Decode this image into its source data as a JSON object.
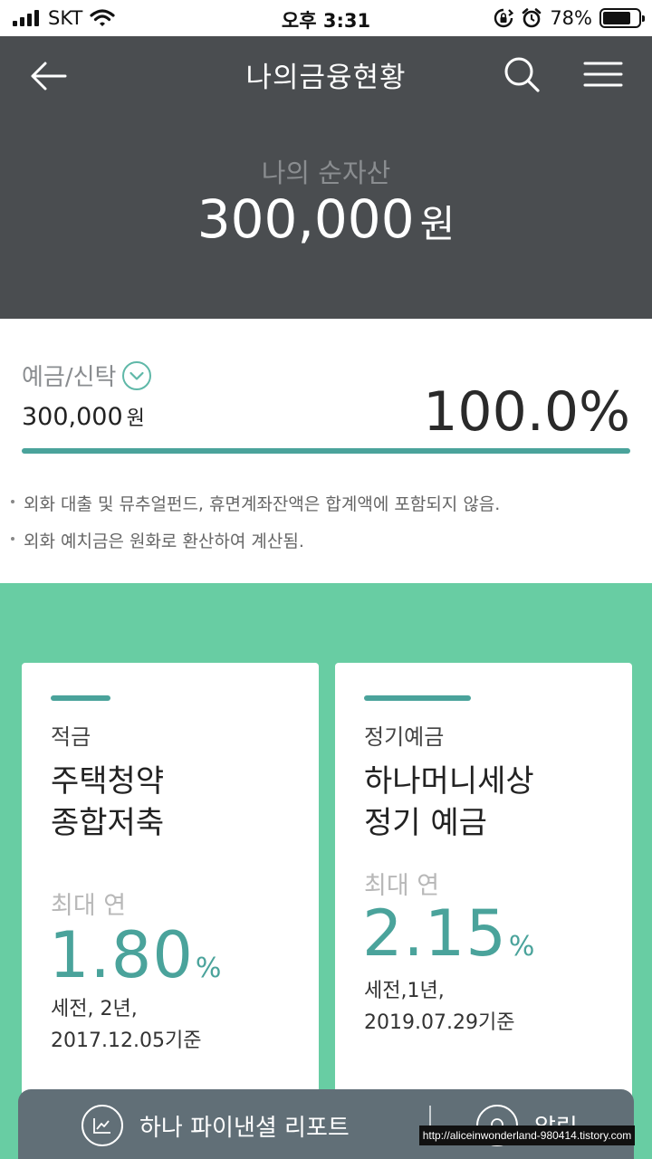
{
  "status_bar": {
    "carrier": "SKT",
    "time": "오후 3:31",
    "battery": "78%",
    "battery_level": 0.78
  },
  "header": {
    "title": "나의금융현황",
    "net_assets_label": "나의 순자산",
    "net_assets_value": "300,000",
    "net_assets_unit": "원"
  },
  "deposit": {
    "label": "예금/신탁",
    "amount": "300,000",
    "unit": "원",
    "percent": "100.0%",
    "share": 1.0,
    "notes": [
      "외화 대출 및 뮤추얼펀드, 휴면계좌잔액은 합계액에 포함되지 않음.",
      "외화 예치금은 원화로 환산하여 계산됨."
    ]
  },
  "products": [
    {
      "category": "적금",
      "name_line1": "주택청약",
      "name_line2": "종합저축",
      "max_label": "최대 연",
      "rate": "1.80",
      "rate_unit": "%",
      "cond_line1": "세전, 2년,",
      "cond_line2": "2017.12.05기준"
    },
    {
      "category": "정기예금",
      "name_line1": "하나머니세상",
      "name_line2": "정기 예금",
      "max_label": "최대 연",
      "rate": "2.15",
      "rate_unit": "%",
      "cond_line1": "세전,1년,",
      "cond_line2": "2019.07.29기준"
    }
  ],
  "bottom_bar": {
    "report_label": "하나 파이낸셜 리포트",
    "alarm_label": "알림"
  },
  "watermark": "http://aliceinwonderland-980414.tistory.com",
  "colors": {
    "header_bg": "#4a4d50",
    "accent": "#4aa39b",
    "products_bg": "#68cda3",
    "bottom_bar_bg": "#616f77"
  },
  "icons": {
    "back": "arrow-left-icon",
    "search": "search-icon",
    "menu": "hamburger-menu-icon",
    "dropdown": "chevron-down-icon",
    "report": "chart-line-icon",
    "alarm": "bell-icon"
  }
}
